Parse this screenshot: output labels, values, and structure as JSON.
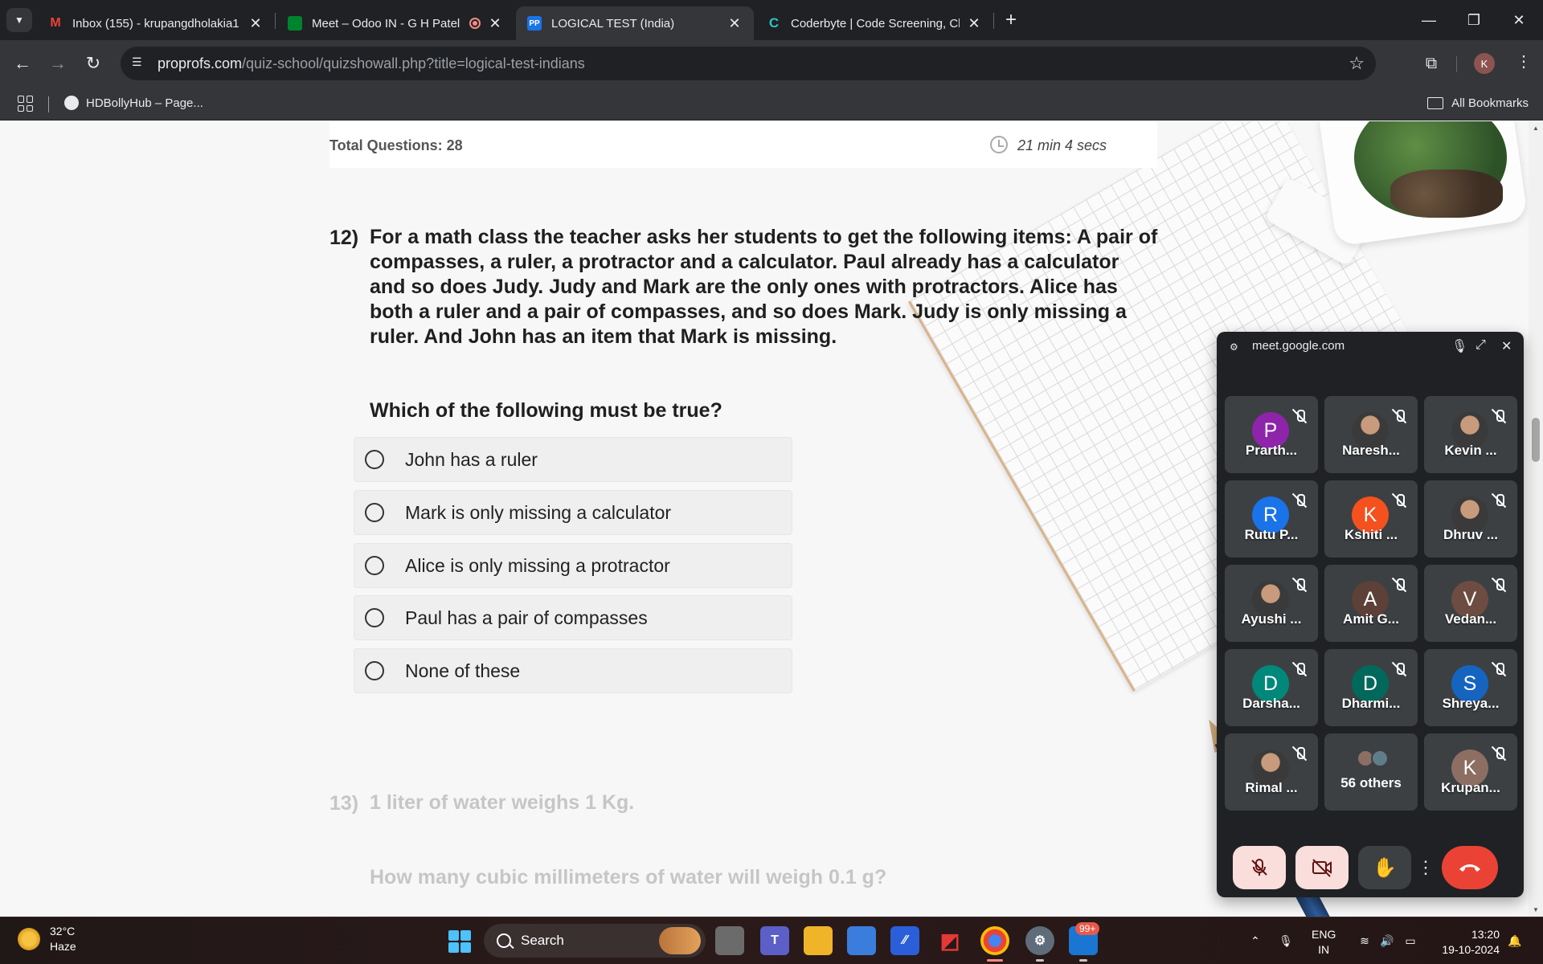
{
  "browser": {
    "tabs": [
      {
        "title": "Inbox (155) - krupangdholakia1",
        "icon": "gmail-icon",
        "active": false
      },
      {
        "title": "Meet – Odoo IN - G H Patel",
        "icon": "meet-icon",
        "active": false,
        "recording": true
      },
      {
        "title": "LOGICAL TEST (India)",
        "icon": "proprofs-icon",
        "icon_text": "PP",
        "active": true
      },
      {
        "title": "Coderbyte | Code Screening, Ch",
        "icon": "coderbyte-icon",
        "icon_text": "C",
        "active": false
      }
    ],
    "url_host": "proprofs.com",
    "url_path": "/quiz-school/quizshowall.php?title=logical-test-indians",
    "profile_initial": "K",
    "bookmarks": [
      {
        "label": "HDBollyHub – Page..."
      }
    ],
    "all_bookmarks": "All Bookmarks"
  },
  "quiz": {
    "total_questions": "Total Questions: 28",
    "timer": "21 min 4 secs",
    "q12": {
      "number": "12)",
      "lines": [
        "For a math class the teacher asks her students to get the following items: A pair of",
        "compasses, a ruler, a protractor and a calculator. Paul already has a calculator",
        "and so does Judy. Judy and Mark are the only ones with protractors. Alice has",
        "both a ruler and a pair of compasses, and so does Mark. Judy is only missing a",
        "ruler. And John has an item that Mark is missing."
      ],
      "prompt": "Which of the following must be true?",
      "options": [
        "John has a ruler",
        "Mark is only missing a calculator",
        "Alice is only missing a protractor",
        "Paul has a pair of compasses",
        "None of these"
      ]
    },
    "q13": {
      "number": "13)",
      "text": "1 liter of water weighs 1 Kg.",
      "prompt": "How many cubic millimeters of water will weigh 0.1 g?"
    }
  },
  "meet": {
    "site": "meet.google.com",
    "participants": [
      {
        "name": "Prarth...",
        "initial": "P",
        "color": "#8e24aa"
      },
      {
        "name": "Naresh...",
        "initial": "",
        "photo": true
      },
      {
        "name": "Kevin ...",
        "initial": "",
        "photo": true
      },
      {
        "name": "Rutu P...",
        "initial": "R",
        "color": "#1a73e8"
      },
      {
        "name": "Kshiti ...",
        "initial": "K",
        "color": "#f4511e"
      },
      {
        "name": "Dhruv ...",
        "initial": "",
        "photo": true
      },
      {
        "name": "Ayushi ...",
        "initial": "",
        "photo": true
      },
      {
        "name": "Amit G...",
        "initial": "A",
        "color": "#5d4037"
      },
      {
        "name": "Vedan...",
        "initial": "V",
        "color": "#6d4c41"
      },
      {
        "name": "Darsha...",
        "initial": "D",
        "color": "#00897b"
      },
      {
        "name": "Dharmi...",
        "initial": "D",
        "color": "#00695c"
      },
      {
        "name": "Shreya...",
        "initial": "S",
        "color": "#1565c0"
      },
      {
        "name": "Rimal ...",
        "initial": "",
        "photo": true
      },
      {
        "name": "Krupan...",
        "initial": "K",
        "color": "#8d6e63"
      }
    ],
    "others_label": "56 others"
  },
  "taskbar": {
    "temperature": "32°C",
    "condition": "Haze",
    "search_label": "Search",
    "notification_badge": "99+",
    "lang_line1": "ENG",
    "lang_line2": "IN",
    "time": "13:20",
    "date": "19-10-2024"
  }
}
